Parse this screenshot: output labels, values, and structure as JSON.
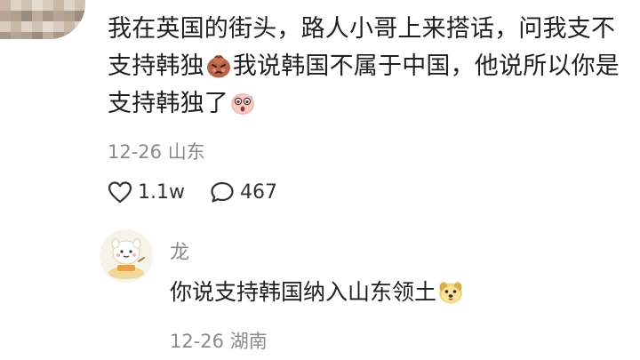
{
  "comment": {
    "line1": "我在英国的街头，路人小哥上来搭话，问我支不",
    "line2_a": "支持韩独",
    "line2_emoji": "angry-face-emoji",
    "line2_b": "我说韩国不属于中国，他说所以你是",
    "line3_a": "支持韩独了",
    "line3_emoji": "shocked-face-emoji",
    "date_location": "12-26 山东",
    "likes": "1.1w",
    "replies": "467"
  },
  "reply": {
    "author": "龙",
    "text": "你说支持韩国纳入山东领土",
    "text_emoji": "dog-face-emoji",
    "date_location": "12-26 湖南"
  },
  "icons": {
    "like": "heart-outline-icon",
    "comment": "speech-bubble-icon"
  },
  "colors": {
    "text_primary": "#1f1f1f",
    "text_secondary": "#8a8a8a",
    "background": "#ffffff"
  }
}
